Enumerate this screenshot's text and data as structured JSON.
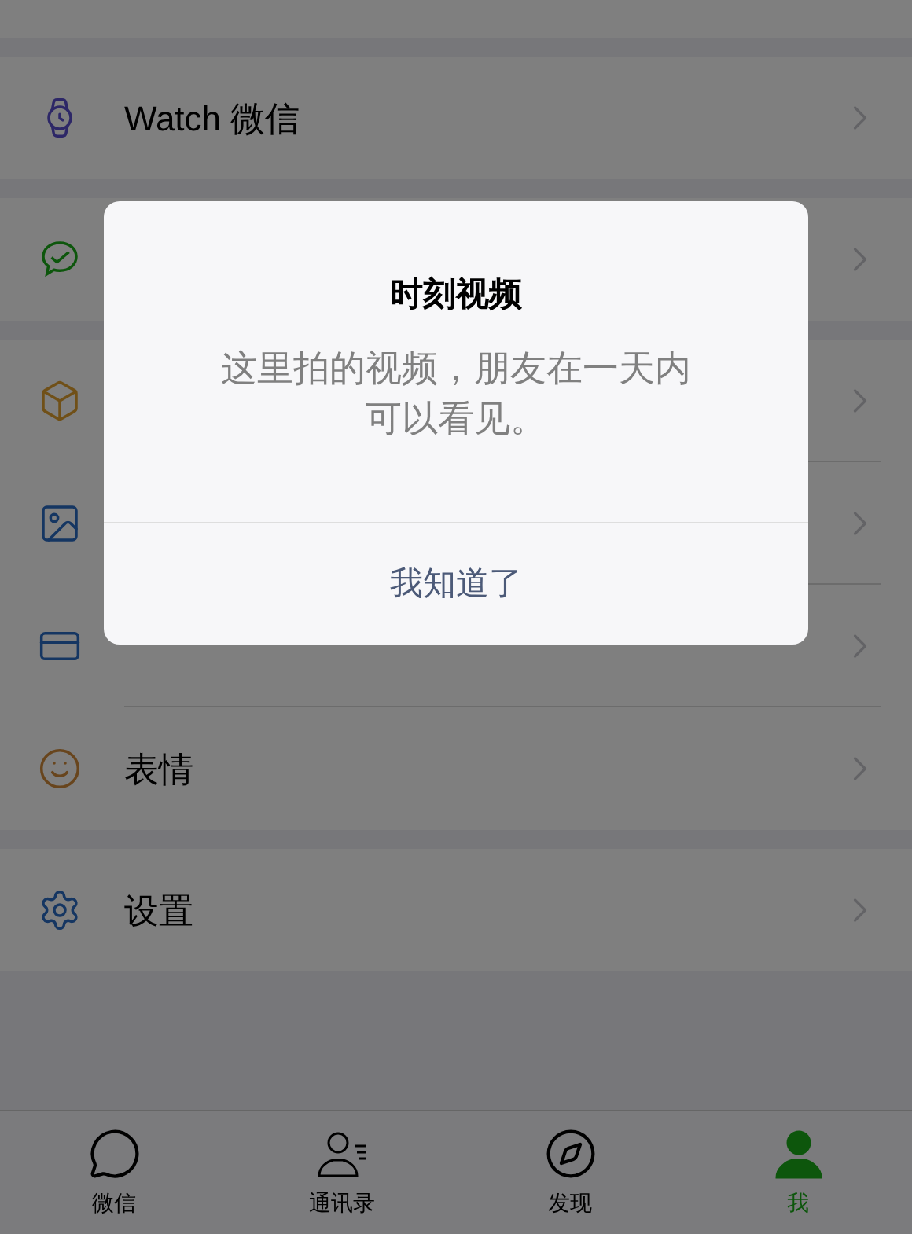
{
  "groups": [
    {
      "rows": [
        {
          "label": "Watch 微信"
        }
      ]
    },
    {
      "rows": [
        {}
      ]
    },
    {
      "rows": [
        {},
        {},
        {},
        {
          "label": "表情"
        }
      ]
    },
    {
      "rows": [
        {
          "label": "设置"
        }
      ]
    }
  ],
  "dialog": {
    "title": "时刻视频",
    "message": "这里拍的视频，朋友在一天内可以看见。",
    "button": "我知道了"
  },
  "tabs": [
    {
      "label": "微信",
      "selected": false
    },
    {
      "label": "通讯录",
      "selected": false
    },
    {
      "label": "发现",
      "selected": false
    },
    {
      "label": "我",
      "selected": true
    }
  ]
}
